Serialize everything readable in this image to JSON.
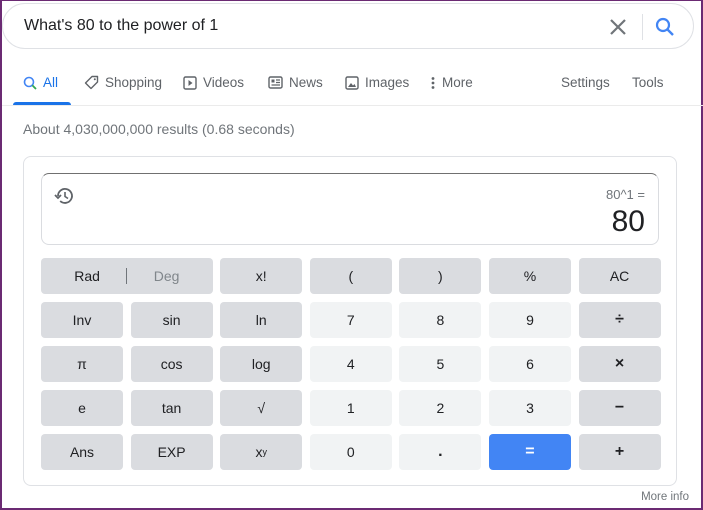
{
  "search": {
    "query": "What's 80 to the power of 1",
    "clear_icon": "close-icon",
    "search_icon": "search-icon"
  },
  "tabs": [
    {
      "label": "All",
      "icon": "search-icon",
      "active": true
    },
    {
      "label": "Shopping",
      "icon": "tag-icon"
    },
    {
      "label": "Videos",
      "icon": "play-icon"
    },
    {
      "label": "News",
      "icon": "news-icon"
    },
    {
      "label": "Images",
      "icon": "image-icon"
    },
    {
      "label": "More",
      "icon": "more-vert-icon"
    }
  ],
  "tools": {
    "settings": "Settings",
    "tools": "Tools"
  },
  "result_stats": "About 4,030,000,000 results (0.68 seconds)",
  "calculator": {
    "expression": "80^1 =",
    "result": "80",
    "history_icon": "history-icon",
    "keys": {
      "rad": "Rad",
      "deg": "Deg",
      "fact": "x!",
      "lparen": "(",
      "rparen": ")",
      "percent": "%",
      "ac": "AC",
      "inv": "Inv",
      "sin": "sin",
      "ln": "ln",
      "k7": "7",
      "k8": "8",
      "k9": "9",
      "div": "÷",
      "pi": "π",
      "cos": "cos",
      "log": "log",
      "k4": "4",
      "k5": "5",
      "k6": "6",
      "mul": "×",
      "e": "e",
      "tan": "tan",
      "sqrt": "√",
      "k1": "1",
      "k2": "2",
      "k3": "3",
      "sub": "−",
      "ans": "Ans",
      "exp": "EXP",
      "pow_base": "x",
      "pow_exp": "y",
      "k0": "0",
      "dot": ".",
      "eq": "=",
      "add": "+"
    }
  },
  "more_info": "More info",
  "colors": {
    "accent": "#1a73e8",
    "equals": "#4285f4"
  }
}
